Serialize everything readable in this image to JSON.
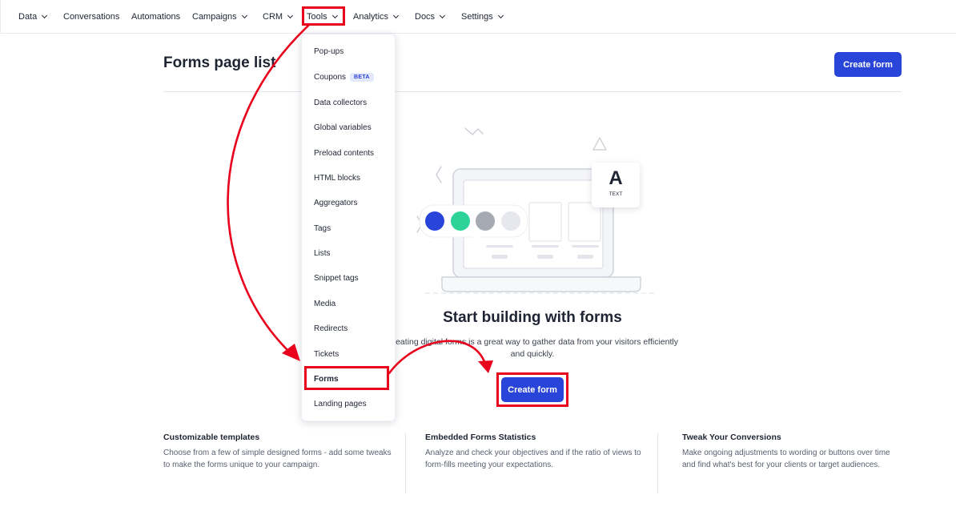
{
  "nav": {
    "items": [
      {
        "label": "Data",
        "chevron": true
      },
      {
        "label": "Conversations",
        "chevron": false
      },
      {
        "label": "Automations",
        "chevron": false
      },
      {
        "label": "Campaigns",
        "chevron": true
      },
      {
        "label": "CRM",
        "chevron": true
      },
      {
        "label": "Tools",
        "chevron": true
      },
      {
        "label": "Analytics",
        "chevron": true
      },
      {
        "label": "Docs",
        "chevron": true
      },
      {
        "label": "Settings",
        "chevron": true
      }
    ]
  },
  "header": {
    "title": "Forms page list",
    "create_label": "Create form"
  },
  "dropdown": {
    "items": [
      {
        "label": "Pop-ups"
      },
      {
        "label": "Coupons",
        "badge": "BETA"
      },
      {
        "label": "Data collectors"
      },
      {
        "label": "Global variables"
      },
      {
        "label": "Preload contents"
      },
      {
        "label": "HTML blocks"
      },
      {
        "label": "Aggregators"
      },
      {
        "label": "Tags"
      },
      {
        "label": "Lists"
      },
      {
        "label": "Snippet tags"
      },
      {
        "label": "Media"
      },
      {
        "label": "Redirects"
      },
      {
        "label": "Tickets"
      },
      {
        "label": "Forms"
      },
      {
        "label": "Landing pages"
      }
    ]
  },
  "illustration": {
    "text_card_letter": "A",
    "text_card_label": "TEXT",
    "swatches": [
      "#2844d9",
      "#2ed39a",
      "#a6abb3",
      "#e6e8ee"
    ]
  },
  "empty_state": {
    "title": "Start building with forms",
    "description": "Creating digital forms is a great way to gather data from your visitors efficiently and quickly.",
    "button_label": "Create form"
  },
  "features": [
    {
      "title": "Customizable templates",
      "text": "Choose from a few of simple designed forms - add some tweaks to make the forms unique to your campaign."
    },
    {
      "title": "Embedded Forms Statistics",
      "text": "Analyze and check your objectives and if the ratio of views to form-fills meeting your expectations."
    },
    {
      "title": "Tweak Your Conversions",
      "text": "Make ongoing adjustments to wording or buttons over time and find what's best for your clients or target audiences."
    }
  ],
  "colors": {
    "primary": "#2844d9",
    "annotation": "#e8001c",
    "text": "#1f2433"
  }
}
